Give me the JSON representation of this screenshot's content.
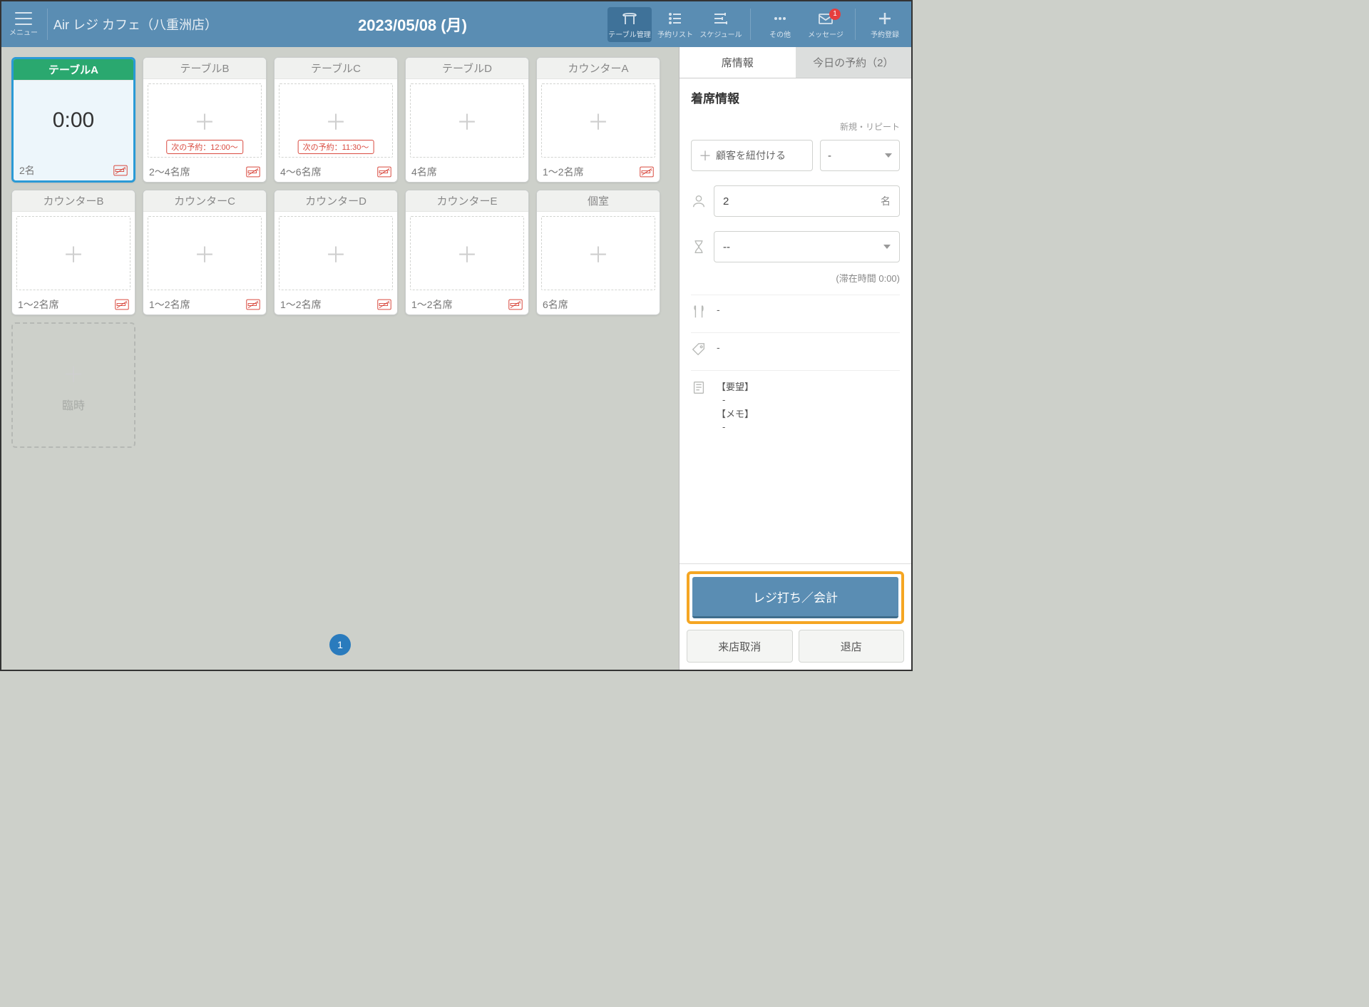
{
  "header": {
    "menu_label": "メニュー",
    "store_name": "Air レジ カフェ（八重洲店）",
    "date": "2023/05/08 (月)",
    "items": [
      {
        "key": "table",
        "label": "テーブル管理"
      },
      {
        "key": "reslist",
        "label": "予約リスト"
      },
      {
        "key": "schedule",
        "label": "スケジュール"
      },
      {
        "key": "other",
        "label": "その他"
      },
      {
        "key": "message",
        "label": "メッセージ",
        "badge": "1"
      },
      {
        "key": "newres",
        "label": "予約登録"
      }
    ]
  },
  "tables": [
    {
      "name": "テーブルA",
      "seats": "2名",
      "timer": "0:00",
      "selected": true,
      "nosmoking": true
    },
    {
      "name": "テーブルB",
      "seats": "2～4名席",
      "next": "次の予約：12:00～",
      "nosmoking": true
    },
    {
      "name": "テーブルC",
      "seats": "4～6名席",
      "next": "次の予約：11:30～",
      "nosmoking": true
    },
    {
      "name": "テーブルD",
      "seats": "4名席"
    },
    {
      "name": "カウンターA",
      "seats": "1～2名席",
      "nosmoking": true
    },
    {
      "name": "カウンターB",
      "seats": "1～2名席",
      "nosmoking": true
    },
    {
      "name": "カウンターC",
      "seats": "1～2名席",
      "nosmoking": true
    },
    {
      "name": "カウンターD",
      "seats": "1～2名席",
      "nosmoking": true
    },
    {
      "name": "カウンターE",
      "seats": "1～2名席",
      "nosmoking": true
    },
    {
      "name": "個室",
      "seats": "6名席"
    }
  ],
  "temp_label": "臨時",
  "page": "1",
  "side": {
    "tab_seat": "席情報",
    "tab_today": "今日の予約（2）",
    "title": "着席情報",
    "repeat_label": "新規・リピート",
    "link_customer": "顧客を紐付ける",
    "repeat_value": "-",
    "party_size": "2",
    "party_suffix": "名",
    "duration_value": "--",
    "stay_note": "(滞在時間 0:00)",
    "course_value": "-",
    "tag_value": "-",
    "req_label": "【要望】",
    "req_value": "-",
    "memo_label": "【メモ】",
    "memo_value": "-",
    "primary": "レジ打ち／会計",
    "cancel": "来店取消",
    "leave": "退店"
  }
}
